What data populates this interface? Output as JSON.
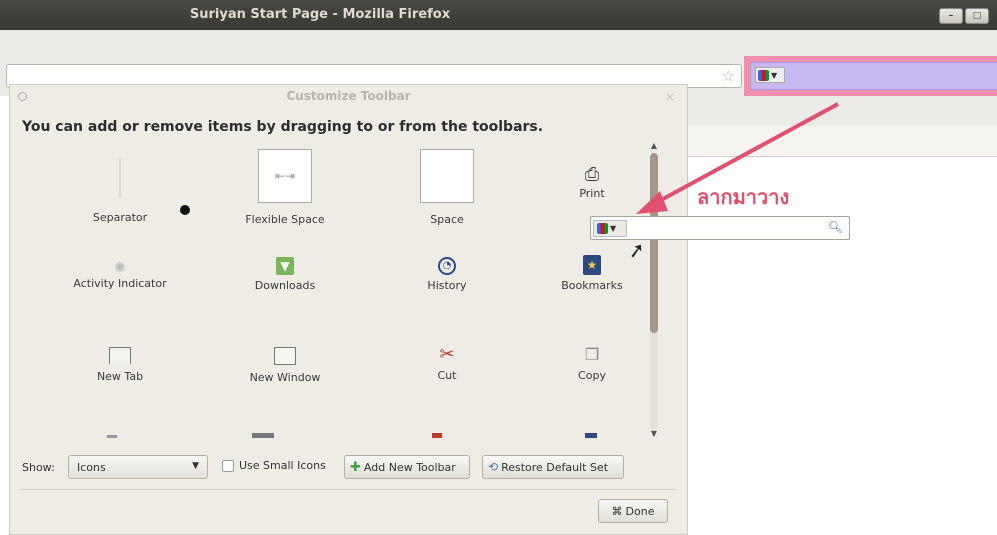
{
  "window": {
    "title": "Suriyan Start Page - Mozilla Firefox",
    "controls": [
      "–",
      "□"
    ]
  },
  "dialog": {
    "title": "Customize Toolbar",
    "close": "×",
    "instruction": "You can add or remove items by dragging to or from the toolbars.",
    "items": [
      {
        "label": "Separator",
        "icon": "separator-icon"
      },
      {
        "label": "Flexible Space",
        "icon": "flexible-space-icon"
      },
      {
        "label": "Space",
        "icon": "space-icon"
      },
      {
        "label": "Print",
        "icon": "print-icon"
      },
      {
        "label": "Activity Indicator",
        "icon": "activity-indicator-icon"
      },
      {
        "label": "Downloads",
        "icon": "downloads-icon"
      },
      {
        "label": "History",
        "icon": "history-icon"
      },
      {
        "label": "Bookmarks",
        "icon": "bookmarks-icon"
      },
      {
        "label": "New Tab",
        "icon": "new-tab-icon"
      },
      {
        "label": "New Window",
        "icon": "new-window-icon"
      },
      {
        "label": "Cut",
        "icon": "cut-icon"
      },
      {
        "label": "Copy",
        "icon": "copy-icon"
      }
    ],
    "show_label": "Show:",
    "show_value": "Icons",
    "small_icons_label": "Use Small Icons",
    "add_toolbar_label": "Add New Toolbar",
    "restore_label": "Restore Default Set",
    "done_label": "Done"
  },
  "annotation": {
    "text": "ลากมาวาง",
    "color": "#e2506f"
  },
  "colors": {
    "highlight": "#f08fab",
    "search_fill": "#c7b8f4"
  }
}
